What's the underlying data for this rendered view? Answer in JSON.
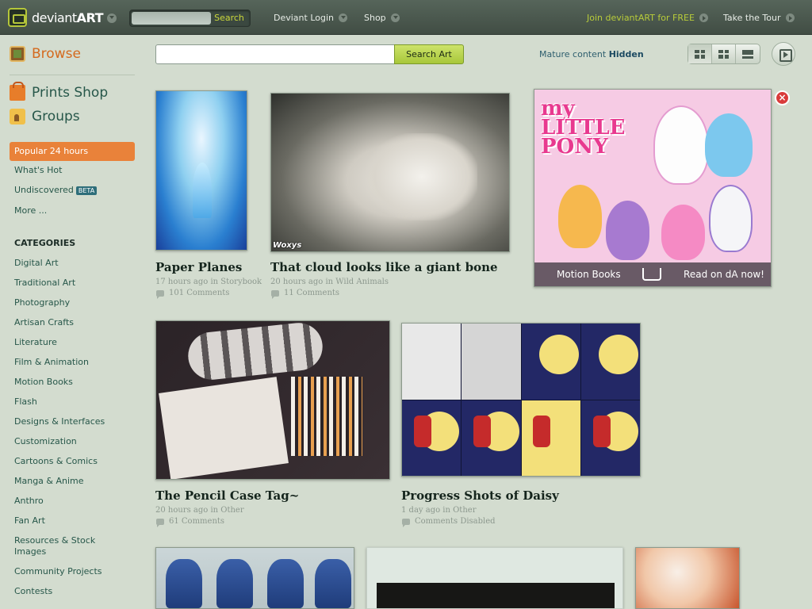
{
  "header": {
    "logo_text": "deviant",
    "logo_text_bold": "ART",
    "search_placeholder": "",
    "search_button": "Search",
    "login_label": "Deviant Login",
    "shop_label": "Shop",
    "join_label": "Join deviantART for FREE",
    "tour_label": "Take the Tour"
  },
  "sidebar": {
    "browse": "Browse",
    "prints_shop": "Prints Shop",
    "groups": "Groups",
    "popular": "Popular 24 hours",
    "whats_hot": "What's Hot",
    "undiscovered": "Undiscovered",
    "beta": "BETA",
    "more": "More ...",
    "categories_heading": "CATEGORIES",
    "categories": [
      "Digital Art",
      "Traditional Art",
      "Photography",
      "Artisan Crafts",
      "Literature",
      "Film & Animation",
      "Motion Books",
      "Flash",
      "Designs & Interfaces",
      "Customization",
      "Cartoons & Comics",
      "Manga & Anime",
      "Anthro",
      "Fan Art",
      "Resources & Stock Images",
      "Community Projects",
      "Contests"
    ]
  },
  "toolbar": {
    "search_value": "",
    "search_button": "Search Art",
    "mature_label": "Mature content",
    "mature_state": "Hidden"
  },
  "deviations": [
    {
      "title": "Paper Planes",
      "meta": "17 hours ago in Storybook",
      "comments": "101 Comments"
    },
    {
      "title": "That cloud looks like a giant bone",
      "meta": "20 hours ago in Wild Animals",
      "comments": "11 Comments",
      "signature": "Woxys"
    },
    {
      "title": "The Pencil Case Tag~",
      "meta": "20 hours ago in Other",
      "comments": "61 Comments"
    },
    {
      "title": "Progress Shots of Daisy",
      "meta": "1 day ago in Other",
      "comments": "Comments Disabled"
    }
  ],
  "ad": {
    "logo_line1": "my",
    "logo_line2": "LITTLE",
    "logo_line3": "PONY",
    "left_text": "Motion Books",
    "right_text": "Read on dA now!",
    "close": "×"
  },
  "colors": {
    "background": "#d3dccf",
    "accent_orange": "#e9823a",
    "link_green": "#27574a",
    "join_green": "#b8cc3a"
  }
}
